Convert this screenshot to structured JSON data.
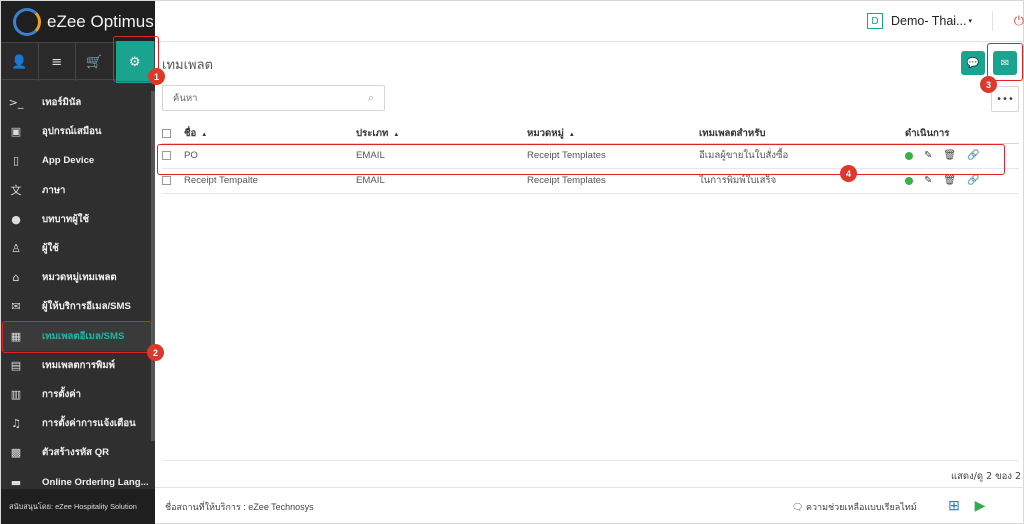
{
  "app": {
    "brand": "eZee Optimus"
  },
  "topbar": {
    "property_badge": "D",
    "property_name": "Demo- Thai...",
    "caret": "▾",
    "power_icon": "⏻"
  },
  "sidebar": {
    "icons": [
      {
        "name": "user-icon",
        "glyph": "👤"
      },
      {
        "name": "list-icon",
        "glyph": "≡"
      },
      {
        "name": "cart-icon",
        "glyph": "🛒"
      },
      {
        "name": "gear-icon",
        "glyph": "⚙"
      }
    ],
    "items": [
      {
        "label": "เทอร์มินัล",
        "icon": ">_"
      },
      {
        "label": "อุปกรณ์เสมือน",
        "icon": "▣"
      },
      {
        "label": "App Device",
        "icon": "▯"
      },
      {
        "label": "ภาษา",
        "icon": "文"
      },
      {
        "label": "บทบาทผู้ใช้",
        "icon": "●"
      },
      {
        "label": "ผู้ใช้",
        "icon": "♙"
      },
      {
        "label": "หมวดหมู่เทมเพลต",
        "icon": "⌂"
      },
      {
        "label": "ผู้ให้บริการอีเมล/SMS",
        "icon": "✉"
      },
      {
        "label": "เทมเพลตอีเมล/SMS",
        "icon": "▦"
      },
      {
        "label": "เทมเพลตการพิมพ์",
        "icon": "▤"
      },
      {
        "label": "การตั้งค่า",
        "icon": "▥"
      },
      {
        "label": "การตั้งค่าการแจ้งเตือน",
        "icon": "♫"
      },
      {
        "label": "ตัวสร้างรหัส QR",
        "icon": "▩"
      },
      {
        "label": "Online Ordering Lang...",
        "icon": "▬"
      }
    ],
    "footer": "สนับสนุนโดย: eZee Hospitality Solution"
  },
  "main": {
    "title": "เทมเพลต",
    "search_placeholder": "ค้นหา",
    "more": "•••",
    "columns": [
      "ชื่อ",
      "ประเภท",
      "หมวดหมู่",
      "เทมเพลตสำหรับ",
      "ดำเนินการ"
    ],
    "rows": [
      {
        "name": "PO",
        "type": "EMAIL",
        "category": "Receipt Templates",
        "template_for": "อีเมลผู้ขายในใบสั่งซื้อ"
      },
      {
        "name": "Receipt Tempalte",
        "type": "EMAIL",
        "category": "Receipt Templates",
        "template_for": "ในการพิมพ์ใบเสร็จ"
      }
    ],
    "pagination": "แสดง/ดู 2 ของ 2"
  },
  "footer": {
    "service": "ชื่อสถานที่ให้บริการ : eZee Technosys",
    "help": "ความช่วยเหลือแบบเรียลไทม์"
  },
  "annotations": [
    "1",
    "2",
    "3",
    "4"
  ],
  "colors": {
    "accent": "#1aa38f",
    "sidebar": "#2f2f2f",
    "annotation": "#e02424",
    "active_dot": "#3cb04a"
  }
}
